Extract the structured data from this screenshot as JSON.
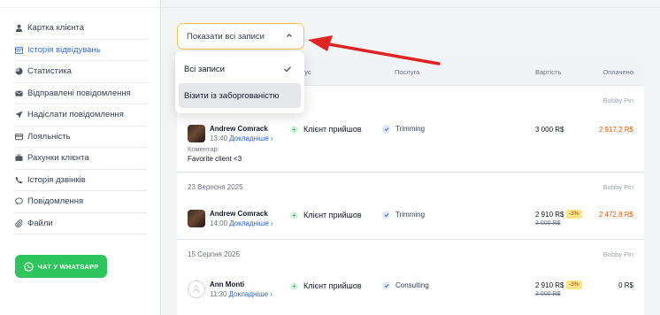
{
  "sidebar": {
    "items": [
      {
        "label": "Картка клієнта",
        "icon": "user-icon",
        "active": false
      },
      {
        "label": "Історія відвідувань",
        "icon": "calendar-icon",
        "active": true
      },
      {
        "label": "Статистика",
        "icon": "pie-chart-icon",
        "active": false
      },
      {
        "label": "Відправлені повідомлення",
        "icon": "envelope-icon",
        "active": false
      },
      {
        "label": "Надіслати повідомлення",
        "icon": "paper-plane-icon",
        "active": false
      },
      {
        "label": "Лояльність",
        "icon": "card-icon",
        "active": false
      },
      {
        "label": "Рахунки клієнта",
        "icon": "briefcase-icon",
        "active": false
      },
      {
        "label": "Історія дзвінків",
        "icon": "phone-icon",
        "active": false
      },
      {
        "label": "Повідомлення",
        "icon": "chat-bubble-icon",
        "active": false
      },
      {
        "label": "Файли",
        "icon": "paperclip-icon",
        "active": false
      }
    ],
    "whatsapp_label": "ЧАТ У WHATSAPP"
  },
  "filter": {
    "selected": "Показати всі записи",
    "options": [
      "Всі записи",
      "Візити із заборгованістю"
    ]
  },
  "table": {
    "columns": {
      "status": "Статус",
      "service": "Послуга",
      "price": "Вартість",
      "paid": "Оплачено"
    },
    "rows": [
      {
        "date": "",
        "staff": "Bobby Pin",
        "client": "Andrew Comrack",
        "time": "13:40",
        "more": "Докладніше ›",
        "comment_label": "Коментар:",
        "comment": "Favorite client <3",
        "status": "Клієнт прийшов",
        "service": "Trimming",
        "price": "3 000 R$",
        "old_price": "",
        "discount": "",
        "paid": "2 917,2 R$"
      },
      {
        "date": "23 Вересня 2025",
        "staff": "Bobby Pin",
        "client": "Andrew Comrack",
        "time": "14:00",
        "more": "Докладніше ›",
        "status": "Клієнт прийшов",
        "service": "Trimming",
        "price": "2 910 R$",
        "old_price": "3 000 R$",
        "discount": "-3%",
        "paid": "2 472,8 R$"
      },
      {
        "date": "15 Серпня 2025",
        "staff": "Bobby Pin",
        "client": "Ann Monti",
        "time": "11:30",
        "more": "Докладніше ›",
        "status": "Клієнт прийшов",
        "service": "Consulting",
        "price": "2 910 R$",
        "old_price": "3 000 R$",
        "discount": "-3%",
        "paid": "0 R$"
      }
    ]
  },
  "colors": {
    "accent": "#3b6fd6",
    "highlight_border": "#f0c44c",
    "whatsapp": "#2ec45e",
    "arrow": "#e02424",
    "paid_debt": "#ea580c",
    "status_plus": "#22a04a"
  }
}
